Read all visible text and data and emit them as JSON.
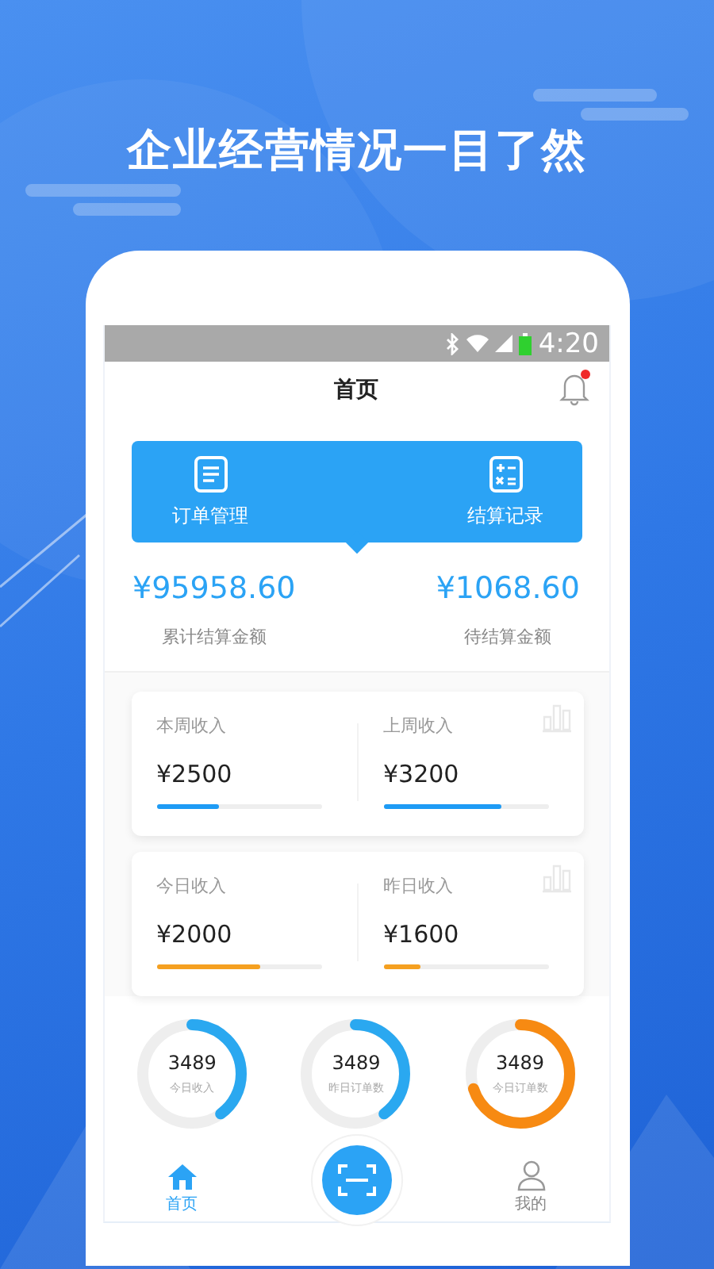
{
  "headline": "企业经营情况一目了然",
  "status_bar": {
    "time": "4:20"
  },
  "nav": {
    "title": "首页",
    "notification": true
  },
  "actions": [
    {
      "label": "订单管理",
      "kind": "document"
    },
    {
      "label": "结算记录",
      "kind": "calculator"
    }
  ],
  "totals": [
    {
      "amount": "¥95958.60",
      "label": "累计结算金额"
    },
    {
      "amount": "¥1068.60",
      "label": "待结算金额"
    }
  ],
  "income_cards": [
    {
      "items": [
        {
          "label": "本周收入",
          "amount": "¥2500",
          "level": 0.38,
          "color": "#1e9bf5"
        },
        {
          "label": "上周收入",
          "amount": "¥3200",
          "level": 0.72,
          "color": "#1e9bf5"
        }
      ]
    },
    {
      "items": [
        {
          "label": "今日收入",
          "amount": "¥2000",
          "level": 0.63,
          "color": "#f5a020"
        },
        {
          "label": "昨日收入",
          "amount": "¥1600",
          "level": 0.23,
          "color": "#f5a020"
        }
      ]
    }
  ],
  "rings": [
    {
      "value": "3489",
      "label": "今日收入",
      "level": 0.4,
      "color": "#2aa8f0"
    },
    {
      "value": "3489",
      "label": "昨日订单数",
      "level": 0.4,
      "color": "#2aa8f0"
    },
    {
      "value": "3489",
      "label": "今日订单数",
      "level": 0.7,
      "color": "#f78a12"
    }
  ],
  "tab_bar": [
    {
      "label": "首页",
      "kind": "home",
      "selected": true
    },
    {
      "kind": "scan"
    },
    {
      "label": "我的",
      "kind": "profile",
      "selected": false
    }
  ]
}
